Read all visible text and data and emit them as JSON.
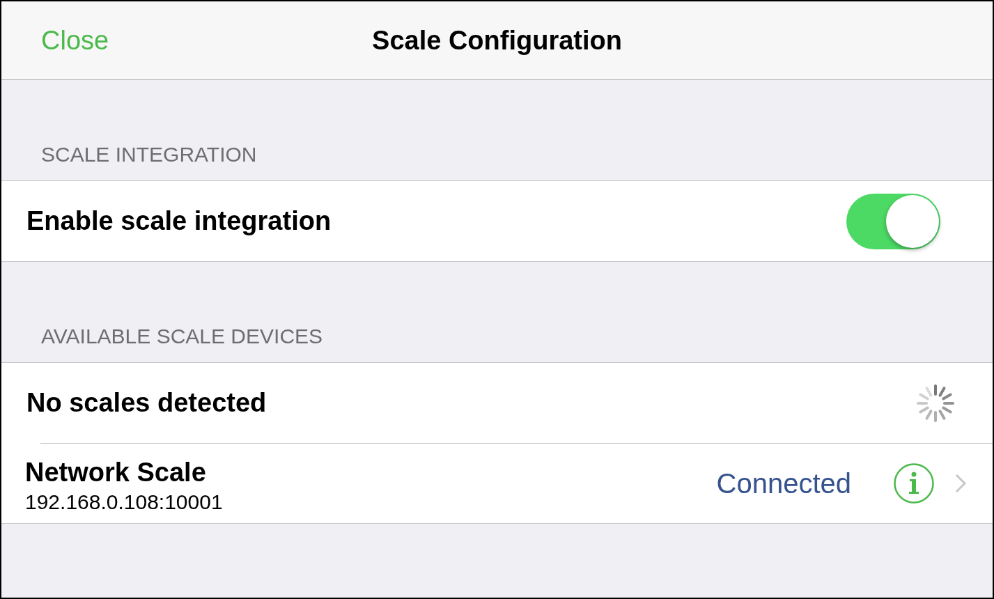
{
  "nav": {
    "close": "Close",
    "title": "Scale Configuration"
  },
  "sections": [
    {
      "header": "SCALE INTEGRATION",
      "rows": [
        {
          "kind": "toggle",
          "label": "Enable scale integration",
          "on": true
        }
      ]
    },
    {
      "header": "AVAILABLE SCALE DEVICES",
      "rows": [
        {
          "kind": "status",
          "label": "No scales detected",
          "loading": true
        },
        {
          "kind": "device",
          "label": "Network Scale",
          "address": "192.168.0.108:10001",
          "status": "Connected"
        }
      ]
    }
  ]
}
